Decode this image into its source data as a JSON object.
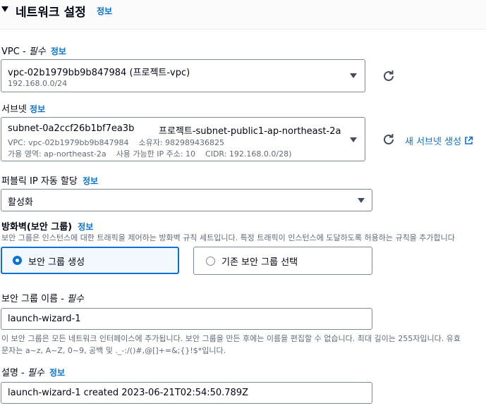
{
  "header": {
    "title": "네트워크 설정",
    "info": "정보"
  },
  "vpc": {
    "label": "VPC - ",
    "required": "필수",
    "info": "정보",
    "value": "vpc-02b1979bb9b847984 (프로젝트-vpc)",
    "cidr": "192.168.0.0/24"
  },
  "subnet": {
    "label": "서브넷",
    "info": "정보",
    "id": "subnet-0a2ccf26b1bf7ea3b",
    "name": "프로젝트-subnet-public1-ap-northeast-2a",
    "line2": "VPC: vpc-02b1979bb9b847984    소유자: 982989436825",
    "line3": "가용 영역: ap-northeast-2a    사용 가능한 IP 주소: 10    CIDR: 192.168.0.0/28)",
    "create_link": "새 서브넷 생성"
  },
  "public_ip": {
    "label": "퍼블릭 IP 자동 할당",
    "info": "정보",
    "value": "활성화"
  },
  "firewall": {
    "label": "방화벽(보안 그룹)",
    "info": "정보",
    "description": "보안 그룹은 인스턴스에 대한 트래픽을 제어하는 방화벽 규칙 세트입니다. 특정 트래픽이 인스턴스에 도달하도록 허용하는 규칙을 추가합니다",
    "options": [
      {
        "label": "보안 그룹 생성",
        "selected": true
      },
      {
        "label": "기존 보안 그룹 선택",
        "selected": false
      }
    ]
  },
  "sg_name": {
    "label": "보안 그룹 이름 - ",
    "required": "필수",
    "value": "launch-wizard-1",
    "help1": "이 보안 그룹은 모든 네트워크 인터페이스에 추가됩니다. 보안 그룹을 만든 후에는 이름을 편집할 수 없습니다. 최대 길이는 255자입니다. 유효",
    "help2": "문자는 a~z, A~Z, 0~9, 공백 및 ._-:/()#,@[]+=&;{}!$*입니다."
  },
  "description": {
    "label": "설명 - ",
    "required": "필수",
    "info": "정보",
    "value": "launch-wizard-1 created 2023-06-21T02:54:50.789Z"
  },
  "colors": {
    "accent": "#0972d3",
    "selected_bg": "#f2f8fd",
    "border": "#7d8998"
  }
}
